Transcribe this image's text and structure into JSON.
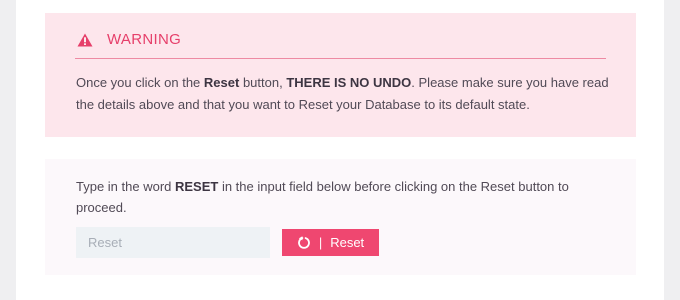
{
  "warning": {
    "title": "WARNING",
    "message": {
      "part1": "Once you click on the ",
      "strong1": "Reset",
      "part2": " button, ",
      "strong2": "THERE IS NO UNDO",
      "part3": ". Please make sure you have read the details above and that you want to Reset your Database to its default state."
    },
    "icon": "warning-triangle-icon"
  },
  "confirm": {
    "instruction": {
      "part1": "Type in the word ",
      "strong": "RESET",
      "part2": " in the input field below before clicking on the Reset button to proceed."
    },
    "input": {
      "placeholder": "Reset",
      "value": ""
    },
    "button": {
      "label": "Reset",
      "separator": "|",
      "icon": "refresh-icon"
    }
  },
  "colors": {
    "accent": "#ef4770",
    "warning_bg": "#fde6ec",
    "confirm_bg": "#fcf8fb"
  }
}
